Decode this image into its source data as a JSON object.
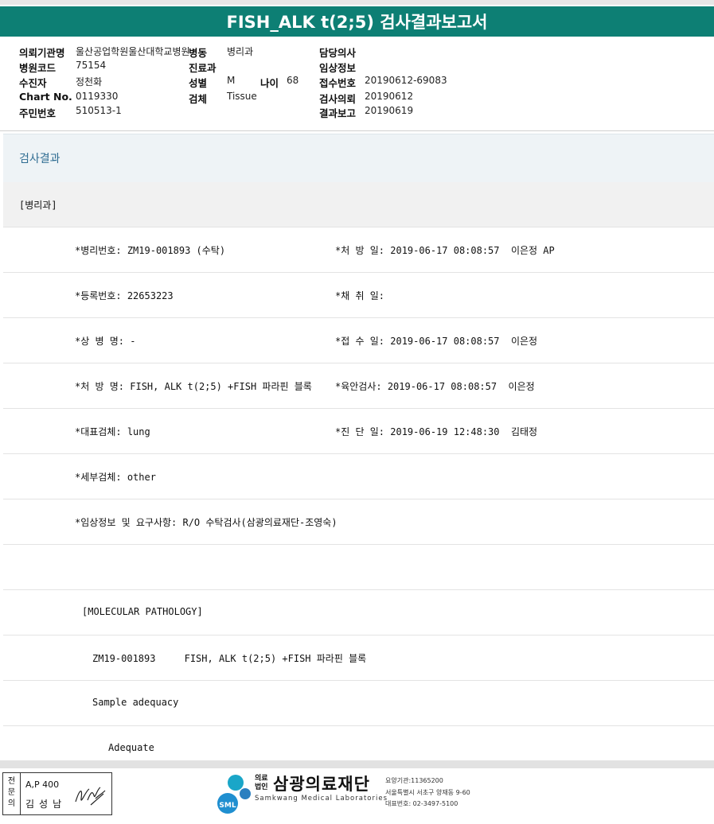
{
  "title": "FISH_ALK t(2;5) 검사결과보고서",
  "info": {
    "c1": [
      {
        "label": "의뢰기관명",
        "value": "울산공업학원울산대학교병원"
      },
      {
        "label": "병원코드",
        "value": "75154"
      },
      {
        "label": "수진자",
        "value": "정천화"
      },
      {
        "label": "Chart No.",
        "value": "0119330"
      },
      {
        "label": "주민번호",
        "value": "510513-1"
      }
    ],
    "c2": [
      {
        "label": "병동",
        "value": "병리과"
      },
      {
        "label": "진료과",
        "value": ""
      },
      {
        "label": "성별",
        "value": "M"
      },
      {
        "label": "검체",
        "value": "Tissue"
      }
    ],
    "age": {
      "label": "나이",
      "value": "68"
    },
    "c3": [
      {
        "label": "담당의사",
        "value": ""
      },
      {
        "label": "임상정보",
        "value": ""
      },
      {
        "label": "접수번호",
        "value": "20190612-69083"
      },
      {
        "label": "검사의뢰",
        "value": "20190612"
      },
      {
        "label": "결과보고",
        "value": "20190619"
      }
    ]
  },
  "section_title": "검사결과",
  "rows": [
    {
      "left": "[병리과]",
      "right": ""
    },
    {
      "left": "*병리번호: ZM19-001893 (수탁)",
      "right": "*처 방 일: 2019-06-17 08:08:57  이은정 AP"
    },
    {
      "left": "*등록번호: 22653223",
      "right": "*채 취 일:"
    },
    {
      "left": "*상 병 명: -",
      "right": "*접 수 일: 2019-06-17 08:08:57  이은정"
    },
    {
      "left": "*처 방 명: FISH, ALK t(2;5) +FISH 파라핀 블록",
      "right": "*육안검사: 2019-06-17 08:08:57  이은정"
    },
    {
      "left": "*대표검체: lung",
      "right": "*진 단 일: 2019-06-19 12:48:30  김태정"
    },
    {
      "left": "*세부검체: other",
      "right": ""
    },
    {
      "left": "*임상정보 및 요구사항: R/O 수탁검사(삼광의료재단-조영숙)",
      "right": ""
    },
    {
      "left": "",
      "right": ""
    },
    {
      "left": "[MOLECULAR PATHOLOGY]",
      "right": ""
    },
    {
      "left": "ZM19-001893     FISH, ALK t(2;5) +FISH 파라핀 블록",
      "right": ""
    },
    {
      "left": "Sample adequacy",
      "right": ""
    },
    {
      "left": "Adequate",
      "right": ""
    }
  ],
  "footer": {
    "stamp_vertical": "전문의",
    "stamp_code": "A,P 400",
    "stamp_name": "김성남",
    "logo_small1": "의료",
    "logo_small2": "법인",
    "logo_name": "삼광의료재단",
    "logo_abbr": "SML",
    "logo_english": "Samkwang Medical Laboratories",
    "contact1": "요양기관:11365200",
    "contact2": "서울특별시 서초구 양재동 9-60",
    "contact3": "대표번호: 02-3497-5100"
  }
}
